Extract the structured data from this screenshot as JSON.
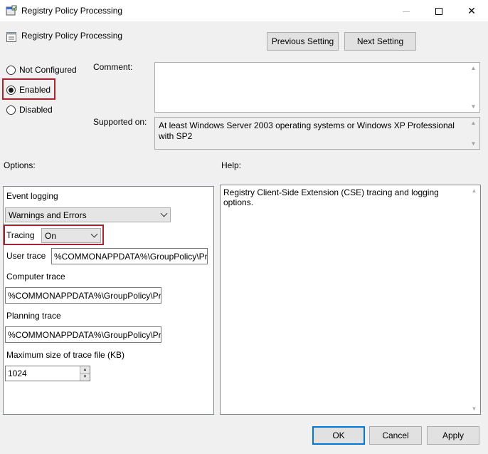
{
  "window": {
    "title": "Registry Policy Processing",
    "min_icon": "minimize-icon",
    "max_icon": "maximize-icon",
    "close_icon": "close-icon",
    "close_glyph": "✕"
  },
  "header": {
    "title": "Registry Policy Processing",
    "previous_label": "Previous Setting",
    "next_label": "Next Setting"
  },
  "state": {
    "options": [
      {
        "label": "Not Configured",
        "checked": false
      },
      {
        "label": "Enabled",
        "checked": true
      },
      {
        "label": "Disabled",
        "checked": false
      }
    ]
  },
  "comment": {
    "label": "Comment:",
    "value": ""
  },
  "supported": {
    "label": "Supported on:",
    "value": "At least Windows Server 2003 operating systems or Windows XP Professional with SP2"
  },
  "options_panel": {
    "label": "Options:",
    "event_logging_label": "Event logging",
    "event_logging_value": "Warnings and Errors",
    "tracing_label": "Tracing",
    "tracing_value": "On",
    "user_trace_label": "User trace",
    "user_trace_value": "%COMMONAPPDATA%\\GroupPolicy\\Pr",
    "computer_trace_label": "Computer trace",
    "computer_trace_value": "%COMMONAPPDATA%\\GroupPolicy\\Pr",
    "planning_trace_label": "Planning trace",
    "planning_trace_value": "%COMMONAPPDATA%\\GroupPolicy\\Pr",
    "max_size_label": "Maximum size of trace file (KB)",
    "max_size_value": "1024"
  },
  "help_panel": {
    "label": "Help:",
    "text": "Registry Client-Side Extension (CSE) tracing and logging options."
  },
  "footer": {
    "ok_label": "OK",
    "cancel_label": "Cancel",
    "apply_label": "Apply"
  },
  "colors": {
    "highlight": "#a4262c",
    "accent": "#0078d7"
  }
}
